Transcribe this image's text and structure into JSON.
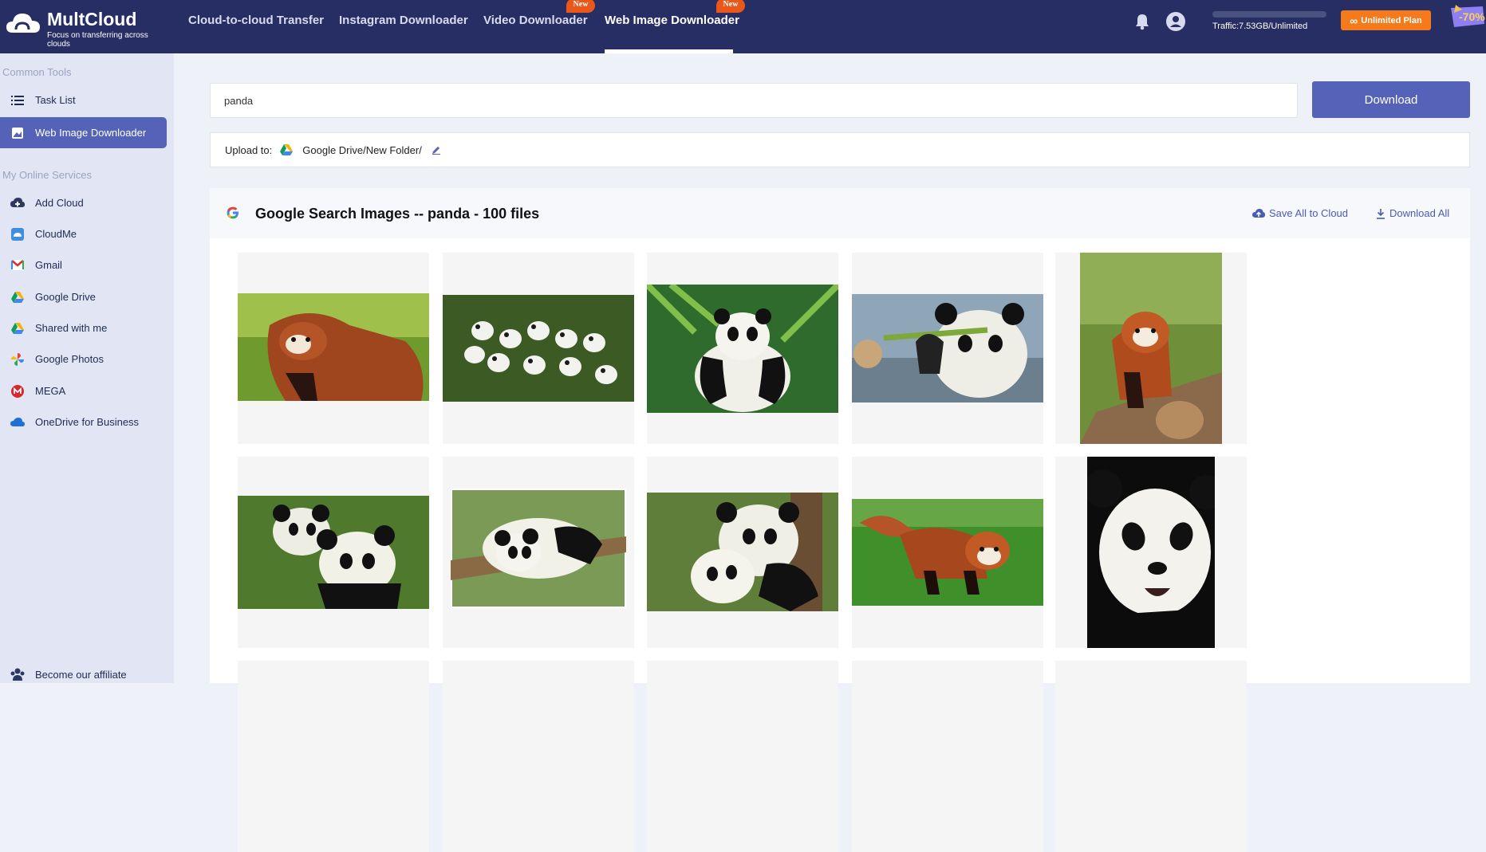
{
  "brand": {
    "name": "MultCloud",
    "tagline": "Focus on transferring across clouds"
  },
  "nav": {
    "items": [
      {
        "label": "Cloud-to-cloud Transfer",
        "badge": ""
      },
      {
        "label": "Instagram Downloader",
        "badge": ""
      },
      {
        "label": "Video Downloader",
        "badge": "New"
      },
      {
        "label": "Web Image Downloader",
        "badge": "New",
        "active": true
      }
    ]
  },
  "account": {
    "traffic": "Traffic:7.53GB/Unlimited",
    "plan_label": "Unlimited Plan",
    "promo": "-70%"
  },
  "sidebar": {
    "common_tools_title": "Common Tools",
    "common_tools": [
      {
        "label": "Task List",
        "icon": "list-icon"
      },
      {
        "label": "Web Image Downloader",
        "icon": "image-download-icon",
        "active": true
      }
    ],
    "online_services_title": "My Online Services",
    "online_services": [
      {
        "label": "Add Cloud",
        "icon": "add-cloud-icon"
      },
      {
        "label": "CloudMe",
        "icon": "cloudme-icon"
      },
      {
        "label": "Gmail",
        "icon": "gmail-icon"
      },
      {
        "label": "Google Drive",
        "icon": "google-drive-icon"
      },
      {
        "label": "Shared with me",
        "icon": "google-drive-icon"
      },
      {
        "label": "Google Photos",
        "icon": "google-photos-icon"
      },
      {
        "label": "MEGA",
        "icon": "mega-icon"
      },
      {
        "label": "OneDrive for Business",
        "icon": "onedrive-icon"
      }
    ],
    "affiliate": "Become our affiliate"
  },
  "search": {
    "value": "panda",
    "button": "Download"
  },
  "upload": {
    "label": "Upload to:",
    "path": "Google Drive/New Folder/"
  },
  "results": {
    "title": "Google Search Images -- panda - 100 files",
    "save_all": "Save All to Cloud",
    "download_all": "Download All",
    "images": [
      {
        "subject": "red-panda"
      },
      {
        "subject": "panda-cubs"
      },
      {
        "subject": "giant-panda-bamboo"
      },
      {
        "subject": "panda-eating"
      },
      {
        "subject": "red-panda-log"
      },
      {
        "subject": "two-pandas"
      },
      {
        "subject": "panda-resting"
      },
      {
        "subject": "pandas-hugging"
      },
      {
        "subject": "red-panda-walking"
      },
      {
        "subject": "panda-portrait"
      }
    ]
  },
  "colors": {
    "topbar": "#262e63",
    "accent": "#5463b8",
    "plan": "#f47a1b",
    "badge": "#e9571a"
  }
}
